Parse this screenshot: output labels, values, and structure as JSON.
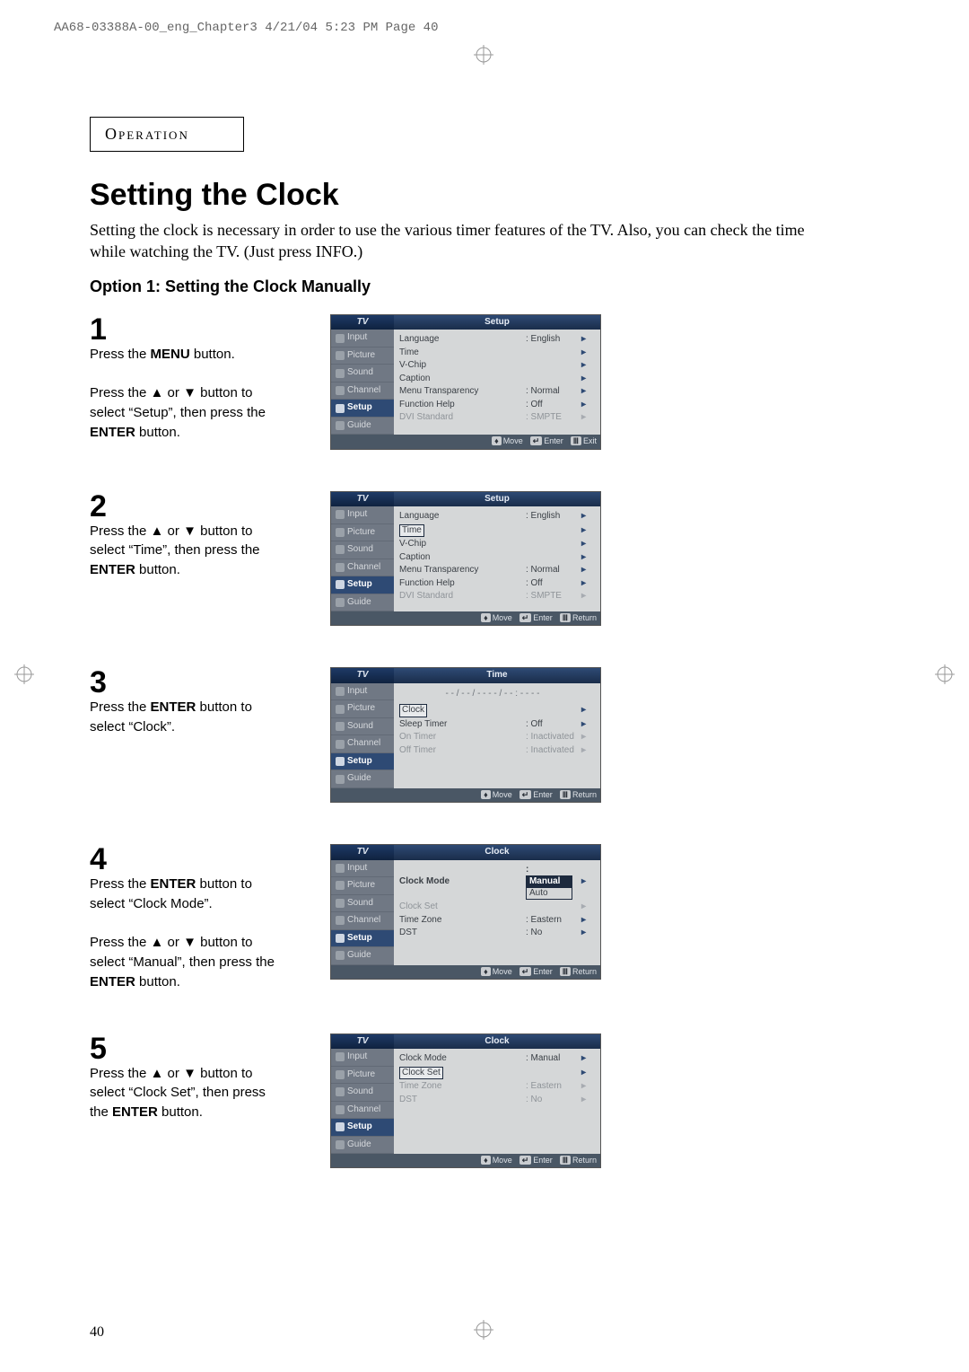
{
  "doc": {
    "running_head": "AA68-03388A-00_eng_Chapter3  4/21/04  5:23 PM  Page 40",
    "section_label": "Operation",
    "title": "Setting the Clock",
    "intro": "Setting the clock is necessary in order to use the various timer features of the TV. Also, you can check the time while watching the TV. (Just press INFO.)",
    "option_heading": "Option 1: Setting the Clock Manually",
    "page_number": "40"
  },
  "steps": {
    "s1": {
      "num": "1",
      "text": "Press the <b>MENU</b> button.<br><br>Press the <span class='arrow'>▲</span> or <span class='arrow'>▼</span> button to select “Setup”, then press the <b>ENTER</b> button."
    },
    "s2": {
      "num": "2",
      "text": "Press the <span class='arrow'>▲</span> or <span class='arrow'>▼</span> button to select “Time”, then press the <b>ENTER</b> button."
    },
    "s3": {
      "num": "3",
      "text": "Press the <b>ENTER</b> button to select “Clock”."
    },
    "s4": {
      "num": "4",
      "text": "Press the <b>ENTER</b> button to select “Clock Mode”.<br><br>Press the <span class='arrow'>▲</span> or <span class='arrow'>▼</span> button to select “Manual”, then press the <b>ENTER</b> button."
    },
    "s5": {
      "num": "5",
      "text": "Press the <span class='arrow'>▲</span> or <span class='arrow'>▼</span> button to select “Clock Set”, then press the <b>ENTER</b> button."
    }
  },
  "osd_common": {
    "tv_label": "TV",
    "tabs": [
      "Input",
      "Picture",
      "Sound",
      "Channel",
      "Setup",
      "Guide"
    ],
    "footer_move": "Move",
    "footer_enter": "Enter",
    "footer_exit": "Exit",
    "footer_return": "Return"
  },
  "osd1": {
    "title": "Setup",
    "selected_tab": 4,
    "rows": [
      {
        "k": "Language",
        "v": ": English",
        "dim": false
      },
      {
        "k": "Time",
        "v": "",
        "dim": false
      },
      {
        "k": "V-Chip",
        "v": "",
        "dim": false
      },
      {
        "k": "Caption",
        "v": "",
        "dim": false
      },
      {
        "k": "Menu Transparency",
        "v": ": Normal",
        "dim": false
      },
      {
        "k": "Function Help",
        "v": ": Off",
        "dim": false
      },
      {
        "k": "DVI Standard",
        "v": ": SMPTE",
        "dim": true
      }
    ],
    "footer_last": "Exit"
  },
  "osd2": {
    "title": "Setup",
    "selected_tab": 4,
    "highlight_row": 1,
    "rows": [
      {
        "k": "Language",
        "v": ": English",
        "dim": false
      },
      {
        "k": "Time",
        "v": "",
        "dim": false,
        "boxed": true
      },
      {
        "k": "V-Chip",
        "v": "",
        "dim": false
      },
      {
        "k": "Caption",
        "v": "",
        "dim": false
      },
      {
        "k": "Menu Transparency",
        "v": ": Normal",
        "dim": false
      },
      {
        "k": "Function Help",
        "v": ": Off",
        "dim": false
      },
      {
        "k": "DVI Standard",
        "v": ": SMPTE",
        "dim": true
      }
    ],
    "footer_last": "Return"
  },
  "osd3": {
    "title": "Time",
    "selected_tab": 4,
    "timestr": "- - / - - / - - - - / - - : - -  - -",
    "rows": [
      {
        "k": "Clock",
        "v": "",
        "dim": false,
        "boxed": true
      },
      {
        "k": "Sleep Timer",
        "v": ": Off",
        "dim": false
      },
      {
        "k": "On Timer",
        "v": ": Inactivated",
        "dim": true
      },
      {
        "k": "Off Timer",
        "v": ": Inactivated",
        "dim": true
      }
    ],
    "footer_last": "Return"
  },
  "osd4": {
    "title": "Clock",
    "selected_tab": 4,
    "rows": [
      {
        "k": "Clock Mode",
        "v_options": [
          "Manual",
          "Auto"
        ],
        "v_sel": 0,
        "bold": true
      },
      {
        "k": "Clock Set",
        "v": "",
        "dim": true
      },
      {
        "k": "Time Zone",
        "v": ": Eastern",
        "dim": false
      },
      {
        "k": "DST",
        "v": ": No",
        "dim": false
      }
    ],
    "footer_last": "Return"
  },
  "osd5": {
    "title": "Clock",
    "selected_tab": 4,
    "rows": [
      {
        "k": "Clock Mode",
        "v": ": Manual",
        "dim": false
      },
      {
        "k": "Clock Set",
        "v": "",
        "dim": false,
        "boxed": true
      },
      {
        "k": "Time Zone",
        "v": ": Eastern",
        "dim": true
      },
      {
        "k": "DST",
        "v": ": No",
        "dim": true
      }
    ],
    "footer_last": "Return"
  }
}
